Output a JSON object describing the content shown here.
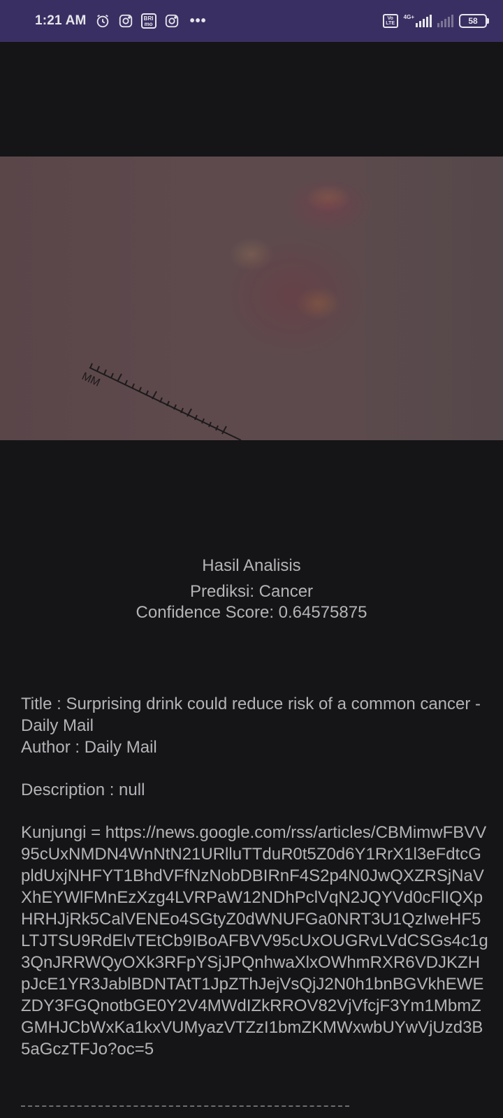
{
  "status_bar": {
    "time": "1:21 AM",
    "left_icons": [
      "alarm-icon",
      "instagram-icon",
      "bri-icon",
      "instagram-icon",
      "more-icon"
    ],
    "bri_label": "BRI mo",
    "more": "•••",
    "volte_label": "Vo LTE",
    "network_label": "4G+",
    "battery": "58"
  },
  "image": {
    "ruler_label": "MM",
    "icon": "skin-lesion-photo"
  },
  "result": {
    "heading": "Hasil Analisis",
    "prediction": "Prediksi: Cancer",
    "confidence": "Confidence Score: 0.64575875"
  },
  "article": {
    "title_line": "Title : Surprising drink could reduce risk of a common cancer - Daily Mail",
    "author_line": "Author : Daily Mail",
    "description_line": "Description : null",
    "visit_line": "Kunjungi =  https://news.google.com/rss/articles/CBMimwFBVV95cUxNMDN4WnNtN21URlluTTduR0t5Z0d6Y1RrX1l3eFdtcGpldUxjNHFYT1BhdVFfNzNobDBIRnF4S2p4N0JwQXZRSjNaVXhEYWlFMnEzXzg4LVRPaW12NDhPclVqN2JQYVd0cFlIQXpHRHJjRk5CalVENEo4SGtyZ0dWNUFGa0NRT3U1QzIweHF5LTJTSU9RdElvTEtCb9IBoAFBVV95cUxOUGRvLVdCSGs4c1g3QnJRRWQyOXk3RFpYSjJPQnhwaXlxOWhmRXR6VDJKZHpJcE1YR3JablBDNTAtT1JpZThJejVsQjJ2N0h1bnBGVkhEWEZDY3FGQnotbGE0Y2V4MWdIZkRROV82VjVfcjF3Ym1MbmZGMHJCbWxKa1kxVUMyazVTZzI1bmZKMWxwbUYwVjUzd3B5aGczTFJo?oc=5",
    "divider": "--------------------------------------------------------------"
  },
  "colors": {
    "status_bar_bg": "#3a2f63",
    "background": "#151517",
    "text": "#b4b4b8"
  }
}
